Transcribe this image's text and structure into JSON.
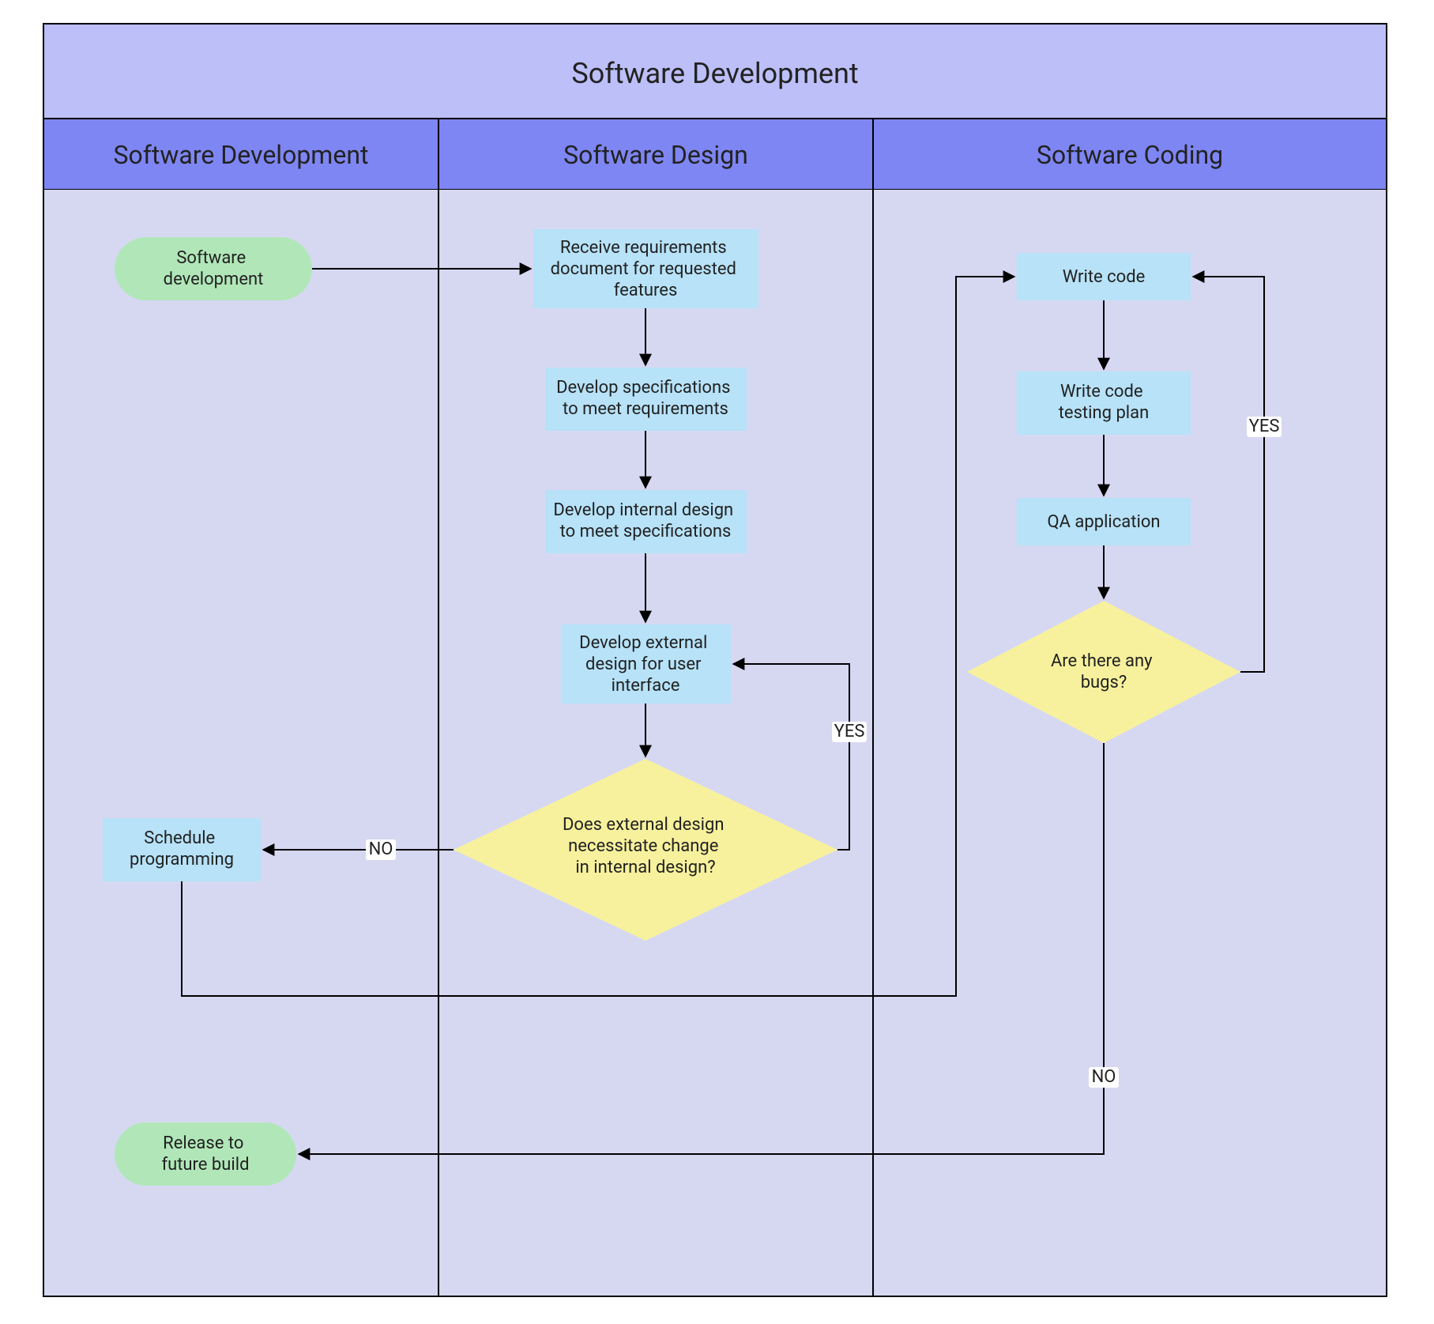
{
  "title": "Software Development",
  "lanes": [
    {
      "id": "dev",
      "label": "Software Development"
    },
    {
      "id": "design",
      "label": "Software Design"
    },
    {
      "id": "coding",
      "label": "Software Coding"
    }
  ],
  "nodes": {
    "start": "Software development",
    "receive": "Receive requirements document for requested features",
    "develop_spec": "Develop specifications to meet requirements",
    "develop_int": "Develop internal design to meet specifications",
    "develop_ext": "Develop external design for user interface",
    "decision1": "Does external design necessitate change in internal design?",
    "schedule": "Schedule programming",
    "write_code": "Write code",
    "write_test": "Write code testing plan",
    "qa": "QA application",
    "decision2": "Are there any bugs?",
    "release": "Release to future build"
  },
  "edge_labels": {
    "yes": "YES",
    "no": "NO"
  },
  "colors": {
    "title_bg": "#bdbff9",
    "lane_hdr": "#7e86f3",
    "lane_body": "#d6d8f2",
    "start_end": "#b1e7b8",
    "process": "#b7e2f8",
    "decision": "#f7f19d",
    "stroke": "#000000"
  }
}
